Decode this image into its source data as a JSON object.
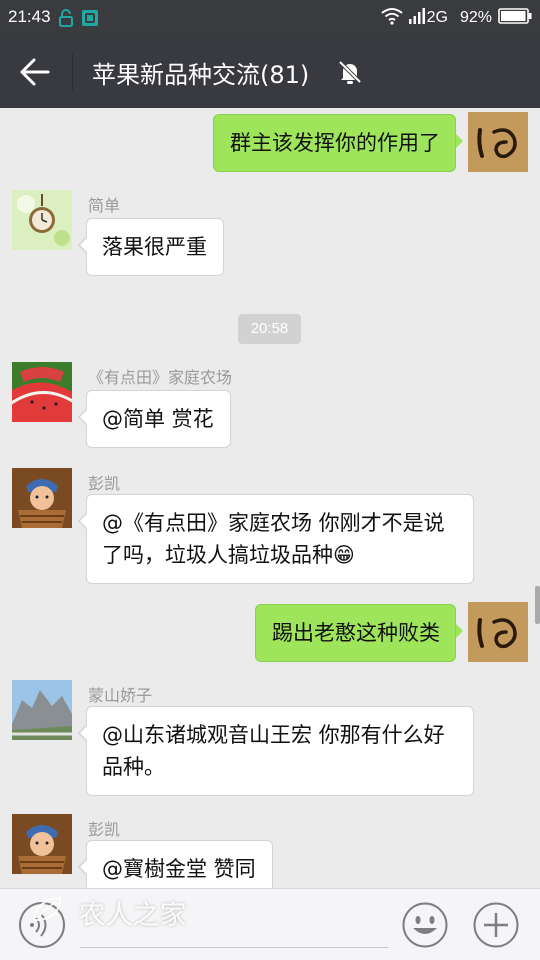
{
  "status_bar": {
    "time": "21:43",
    "network": "2G",
    "battery": "92%",
    "icons": [
      "lock-icon",
      "screenshot-icon",
      "wifi-icon",
      "signal-icon",
      "battery-icon"
    ]
  },
  "header": {
    "title": "苹果新品种交流(81)",
    "icons": [
      "back-arrow-icon",
      "mute-bell-icon"
    ]
  },
  "messages": [
    {
      "side": "right",
      "text": "群主该发挥你的作用了",
      "avatar": "calligraphy-avatar"
    },
    {
      "side": "left",
      "sender": "简单",
      "text": "落果很严重",
      "avatar": "pocket-watch-avatar"
    },
    {
      "timestamp": "20:58"
    },
    {
      "side": "left",
      "sender": "《有点田》家庭农场",
      "text": "@简单 赏花",
      "avatar": "watermelon-avatar"
    },
    {
      "side": "left",
      "sender": "彭凯",
      "text": "@《有点田》家庭农场 你刚才不是说了吗，垃圾人搞垃圾品种😁",
      "avatar": "baby-avatar"
    },
    {
      "side": "right",
      "text": "踢出老憨这种败类",
      "avatar": "calligraphy-avatar"
    },
    {
      "side": "left",
      "sender": "蒙山娇子",
      "text": "@山东诸城观音山王宏 你那有什么好品种。",
      "avatar": "mountain-avatar"
    },
    {
      "side": "left",
      "sender": "彭凯",
      "text": "@寶樹金堂 赞同",
      "avatar": "baby-avatar"
    }
  ],
  "input_bar": {
    "icons": [
      "voice-icon",
      "emoji-icon",
      "plus-icon"
    ]
  },
  "watermark": "农人之家",
  "colors": {
    "title_bar": "#393a3f",
    "chat_background": "#ebebeb",
    "sent_bubble": "#9ee55c",
    "received_bubble": "#ffffff"
  }
}
